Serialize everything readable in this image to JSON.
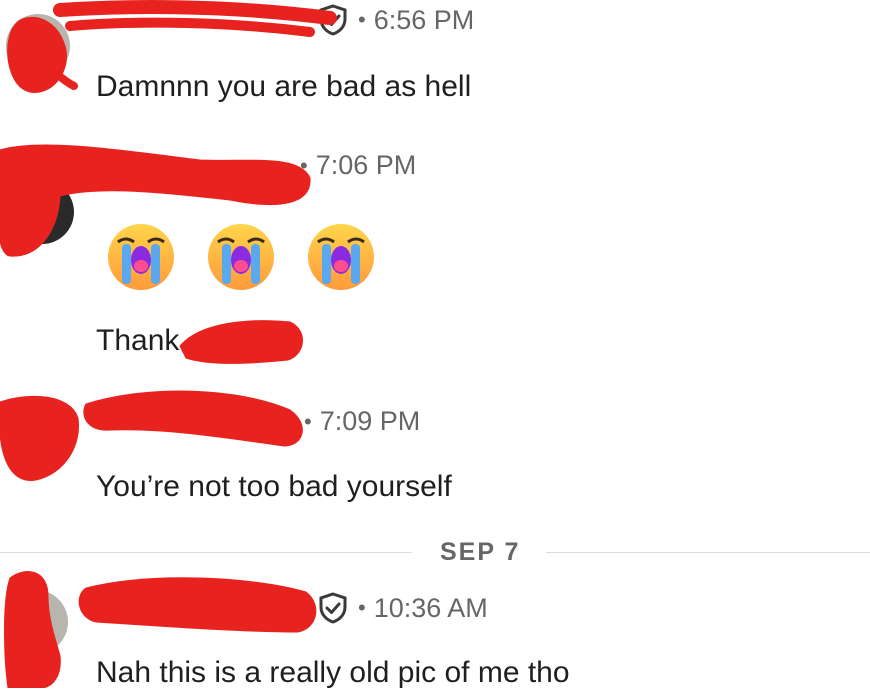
{
  "conversation": {
    "messages": [
      {
        "sender_name": "",
        "verified": true,
        "time": "6:56 PM",
        "text": "Damnnn you are bad as hell"
      },
      {
        "sender_name": "",
        "verified": false,
        "time": "7:06 PM",
        "emojis": [
          "loudly-crying-face",
          "loudly-crying-face",
          "loudly-crying-face"
        ],
        "text": "Thank"
      },
      {
        "sender_name": "",
        "verified": false,
        "time": "7:09 PM",
        "text": "You’re not too bad yourself"
      },
      {
        "sender_name": "",
        "verified": true,
        "time": "10:36 AM",
        "text": "Nah this is a really old pic of me tho"
      }
    ],
    "date_divider": "SEP 7",
    "separator": "•"
  },
  "colors": {
    "redaction": "#e8231f",
    "meta_text": "#666666",
    "body_text": "#1f1f1f"
  },
  "icons": {
    "verified": "shield-check-icon",
    "reaction": "loudly-crying-face-emoji"
  }
}
